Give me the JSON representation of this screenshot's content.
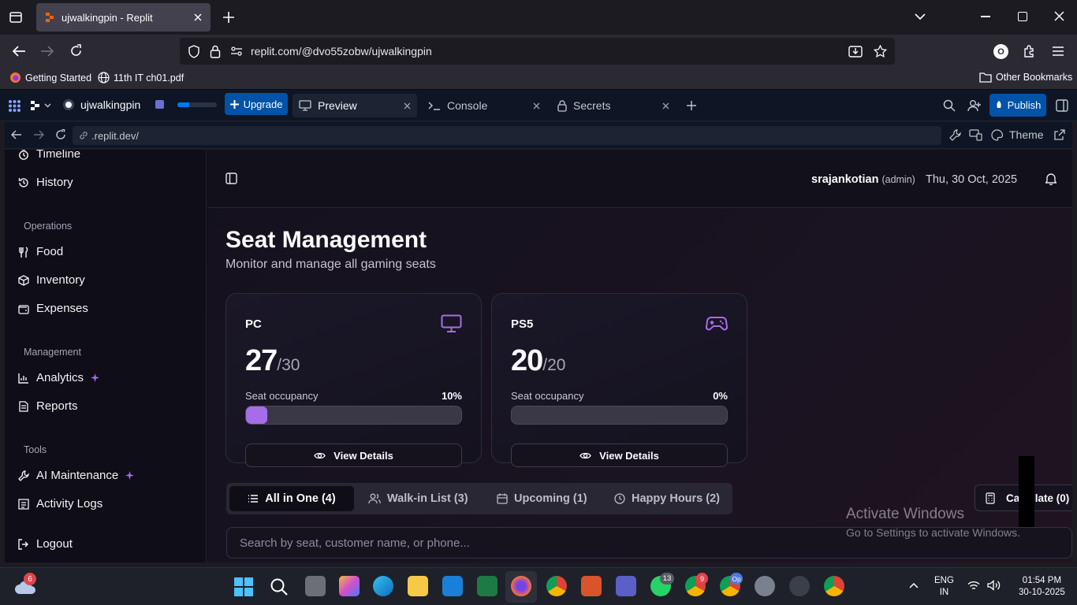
{
  "browser": {
    "tab_title": "ujwalkingpin - Replit",
    "url": "replit.com/@dvo55zobw/ujwalkingpin",
    "bookmarks": [
      "Getting Started",
      "11th IT ch01.pdf"
    ],
    "other_bookmarks": "Other Bookmarks"
  },
  "replit": {
    "repl_name": "ujwalkingpin",
    "upgrade": "Upgrade",
    "tabs": [
      "Preview",
      "Console",
      "Secrets"
    ],
    "publish": "Publish",
    "preview_url": ".replit.dev/",
    "theme": "Theme"
  },
  "sidebar": {
    "top_items": [
      "Timeline",
      "History"
    ],
    "sections": [
      {
        "title": "Operations",
        "items": [
          "Food",
          "Inventory",
          "Expenses"
        ]
      },
      {
        "title": "Management",
        "items": [
          "Analytics",
          "Reports"
        ]
      },
      {
        "title": "Tools",
        "items": [
          "AI Maintenance",
          "Activity Logs"
        ]
      }
    ],
    "logout": "Logout"
  },
  "header": {
    "user": "srajankotian",
    "role": "(admin)",
    "date": "Thu, 30 Oct, 2025"
  },
  "page": {
    "title": "Seat Management",
    "subtitle": "Monitor and manage all gaming seats"
  },
  "cards": [
    {
      "name": "PC",
      "available": "27",
      "total": "/30",
      "occupancy_label": "Seat occupancy",
      "occupancy": "10%",
      "occupancy_fraction": 0.1,
      "button": "View Details",
      "icon": "monitor-icon"
    },
    {
      "name": "PS5",
      "available": "20",
      "total": "/20",
      "occupancy_label": "Seat occupancy",
      "occupancy": "0%",
      "occupancy_fraction": 0,
      "button": "View Details",
      "icon": "gamepad-icon"
    }
  ],
  "booking_tabs": [
    "All in One (4)",
    "Walk-in List (3)",
    "Upcoming (1)",
    "Happy Hours (2)"
  ],
  "calculate": "Calculate (0)",
  "search_placeholder": "Search by seat, customer name, or phone...",
  "watermark": {
    "title": "Activate Windows",
    "subtitle": "Go to Settings to activate Windows."
  },
  "taskbar": {
    "weather_badge": "6",
    "lang": "ENG",
    "region": "IN",
    "time": "01:54 PM",
    "date": "30-10-2025",
    "badges": [
      "13",
      "9",
      "Op"
    ]
  },
  "colors": {
    "accent": "#a56ee8",
    "brand_blue": "#0079f2"
  }
}
